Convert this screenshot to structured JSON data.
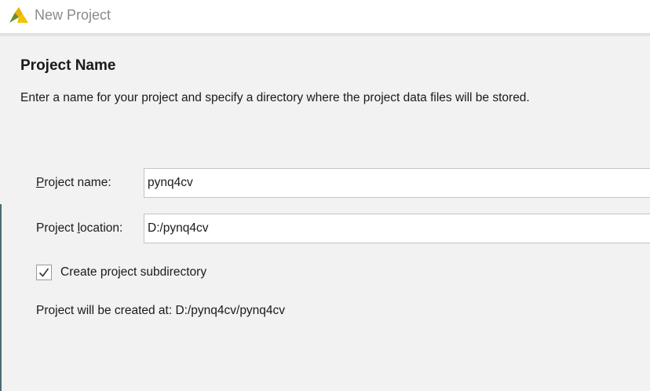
{
  "window": {
    "title": "New Project",
    "app_icon": "vivado-logo-icon"
  },
  "page": {
    "title": "Project Name",
    "description": "Enter a name for your project and specify a directory where the project data files will be stored."
  },
  "form": {
    "name": {
      "label_mnemonic": "P",
      "label_rest": "roject name:",
      "value": "pynq4cv"
    },
    "location": {
      "label_pre": "Project ",
      "label_mnemonic": "l",
      "label_rest": "ocation:",
      "value": "D:/pynq4cv"
    },
    "subdirectory": {
      "checked": true,
      "label": "Create project subdirectory"
    },
    "created_at": "Project will be created at: D:/pynq4cv/pynq4cv"
  },
  "colors": {
    "background": "#f2f2f2",
    "logo_yellow": "#e8b400",
    "logo_green": "#6a8f2a"
  }
}
